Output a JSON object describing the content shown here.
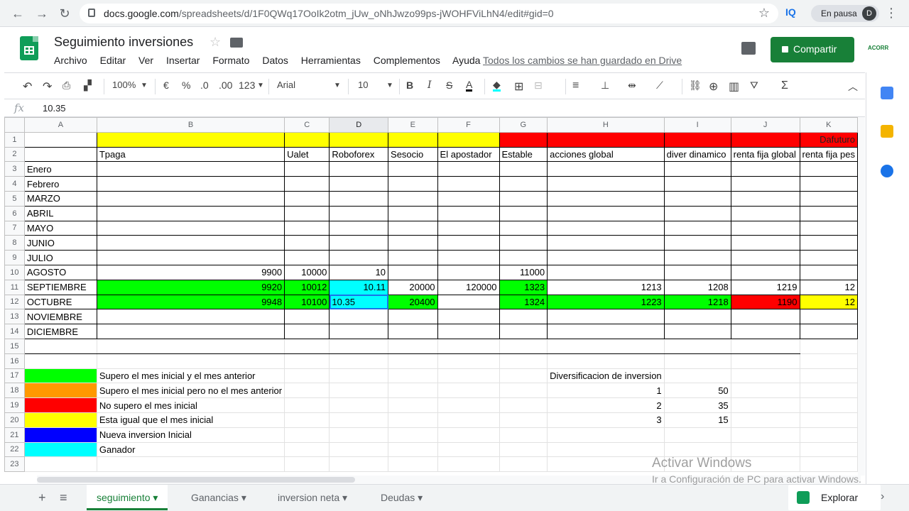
{
  "browser": {
    "url_host": "docs.google.com",
    "url_path": "/spreadsheets/d/1F0QWq17OoIk2otm_jUw_oNhJwzo99ps-jWOHFViLhN4/edit#gid=0",
    "ext_label": "IQ",
    "profile_status": "En pausa",
    "profile_initial": "D"
  },
  "doc": {
    "title": "Seguimiento inversiones",
    "menus": [
      "Archivo",
      "Editar",
      "Ver",
      "Insertar",
      "Formato",
      "Datos",
      "Herramientas",
      "Complementos",
      "Ayuda"
    ],
    "saved_status": "Todos los cambios se han guardado en Drive",
    "share_label": "Compartir",
    "brand_label": "ACORR"
  },
  "toolbar": {
    "zoom": "100%",
    "currency": "€",
    "percent": "%",
    "dec_less": ".0",
    "dec_more": ".00",
    "format_more": "123",
    "font": "Arial",
    "font_size": "10",
    "bold": "B",
    "italic": "I",
    "strike": "S",
    "text_color": "A"
  },
  "formula": {
    "fx": "fx",
    "value": "10.35"
  },
  "sheet": {
    "columns": [
      "A",
      "B",
      "C",
      "D",
      "E",
      "F",
      "G",
      "H",
      "I",
      "J",
      "K"
    ],
    "selected_column": "D",
    "r1_label": "Dafuturo",
    "r2": [
      "",
      "Tpaga",
      "Ualet",
      "Roboforex",
      "Sesocio",
      "El apostador",
      "Estable",
      "acciones global",
      "diver dinamico",
      "renta fija global",
      "renta fija pes"
    ],
    "months": [
      "Enero",
      "Febrero",
      "MARZO",
      "ABRIL",
      "MAYO",
      "JUNIO",
      "JULIO",
      "AGOSTO",
      "SEPTIEMBRE",
      "OCTUBRE",
      "NOVIEMBRE",
      "DICIEMBRE"
    ],
    "r10": [
      "",
      "9900",
      "10000",
      "10",
      "",
      "",
      "11000",
      "",
      "",
      "",
      ""
    ],
    "r11": [
      "",
      "9920",
      "10012",
      "10.11",
      "20000",
      "120000",
      "1323",
      "1213",
      "1208",
      "1219",
      "12"
    ],
    "r12": [
      "",
      "9948",
      "10100",
      "10.35",
      "20400",
      "",
      "1324",
      "1223",
      "1218",
      "1190",
      "12"
    ],
    "legend": [
      {
        "color": "#00ff00",
        "text": "Supero el mes inicial y el mes anterior"
      },
      {
        "color": "#ff9900",
        "text": "Supero el mes inicial pero no el mes anterior"
      },
      {
        "color": "#ff0000",
        "text": "No supero el mes inicial"
      },
      {
        "color": "#ffff00",
        "text": "Esta igual que el mes inicial"
      },
      {
        "color": "#0000ff",
        "text": "Nueva inversion Inicial"
      },
      {
        "color": "#00ffff",
        "text": "Ganador"
      }
    ],
    "diversification_title": "Diversificacion de inversion",
    "diversification": [
      [
        "1",
        "50"
      ],
      [
        "2",
        "35"
      ],
      [
        "3",
        "15"
      ]
    ]
  },
  "tabs": {
    "items": [
      "seguimiento",
      "Ganancias",
      "inversion neta",
      "Deudas"
    ],
    "active": "seguimiento",
    "explore_label": "Explorar"
  },
  "watermark": {
    "line1": "Activar Windows",
    "line2": "Ir a Configuración de PC para activar Windows."
  }
}
